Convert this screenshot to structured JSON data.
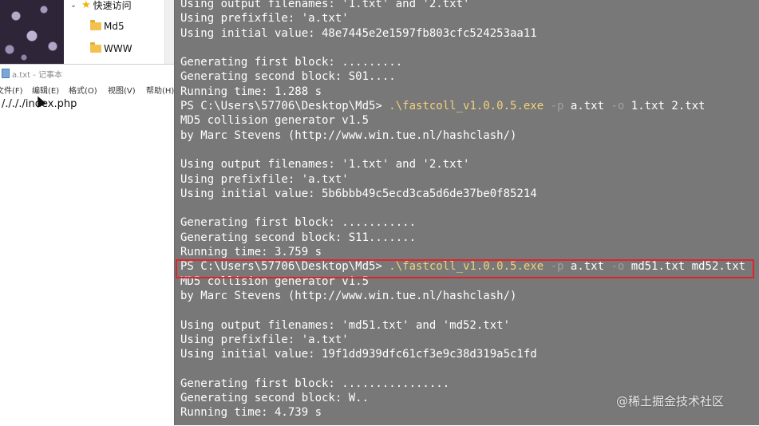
{
  "explorer": {
    "quick_access": "快速访问",
    "folders": [
      "Md5",
      "WWW"
    ]
  },
  "notepad": {
    "title": "a.txt - 记事本",
    "menu": [
      "文件(F)",
      "编辑(E)",
      "格式(O)",
      "视图(V)",
      "帮助(H)"
    ],
    "content": "/./././index.php"
  },
  "console": {
    "lines": [
      {
        "text": "Using output filenames: '1.txt' and '2.txt'"
      },
      {
        "text": "Using prefixfile: 'a.txt'"
      },
      {
        "text": "Using initial value: 48e7445e2e1597fb803cfc524253aa11"
      },
      {
        "text": ""
      },
      {
        "text": "Generating first block: ........."
      },
      {
        "text": "Generating second block: S01...."
      },
      {
        "text": "Running time: 1.288 s"
      },
      {
        "prompt": "PS C:\\Users\\57706\\Desktop\\Md5> ",
        "exe": ".\\fastcoll_v1.0.0.5.exe",
        "args": [
          {
            "flag": " -p",
            "val": " a.txt"
          },
          {
            "flag": " -o",
            "val": " 1.txt 2.txt"
          }
        ]
      },
      {
        "text": "MD5 collision generator v1.5"
      },
      {
        "text": "by Marc Stevens (http://www.win.tue.nl/hashclash/)"
      },
      {
        "text": ""
      },
      {
        "text": "Using output filenames: '1.txt' and '2.txt'"
      },
      {
        "text": "Using prefixfile: 'a.txt'"
      },
      {
        "text": "Using initial value: 5b6bbb49c5ecd3ca5d6de37be0f85214"
      },
      {
        "text": ""
      },
      {
        "text": "Generating first block: ..........."
      },
      {
        "text": "Generating second block: S11......."
      },
      {
        "text": "Running time: 3.759 s"
      },
      {
        "prompt": "PS C:\\Users\\57706\\Desktop\\Md5> ",
        "exe": ".\\fastcoll_v1.0.0.5.exe",
        "args": [
          {
            "flag": " -p",
            "val": " a.txt"
          },
          {
            "flag": " -o",
            "val": " md51.txt md52.txt"
          }
        ]
      },
      {
        "text": "MD5 collision generator v1.5"
      },
      {
        "text": "by Marc Stevens (http://www.win.tue.nl/hashclash/)"
      },
      {
        "text": ""
      },
      {
        "text": "Using output filenames: 'md51.txt' and 'md52.txt'"
      },
      {
        "text": "Using prefixfile: 'a.txt'"
      },
      {
        "text": "Using initial value: 19f1dd939dfc61cf3e9c38d319a5c1fd"
      },
      {
        "text": ""
      },
      {
        "text": "Generating first block: ................"
      },
      {
        "text": "Generating second block: W.."
      },
      {
        "text": "Running time: 4.739 s"
      }
    ],
    "watermark": "@稀土掘金技术社区"
  },
  "colors": {
    "console_bg": "#787878",
    "command_exe": "#f3d27a",
    "highlight_border": "#e0242b"
  }
}
